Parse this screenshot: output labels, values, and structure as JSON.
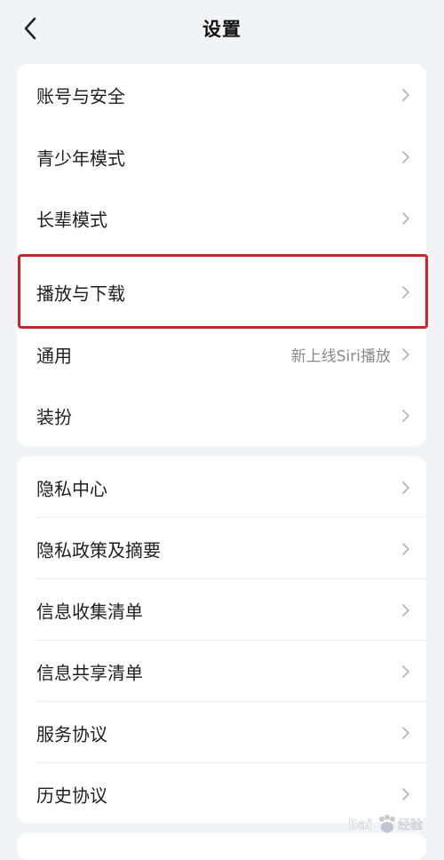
{
  "header": {
    "title": "设置",
    "back_icon": "chevron-left-icon"
  },
  "groups": [
    {
      "items": [
        {
          "label": "账号与安全",
          "hint": ""
        },
        {
          "label": "青少年模式",
          "hint": ""
        },
        {
          "label": "长辈模式",
          "hint": ""
        },
        {
          "label": "播放与下载",
          "hint": "",
          "highlighted": true
        },
        {
          "label": "通用",
          "hint": "新上线Siri播放"
        },
        {
          "label": "装扮",
          "hint": ""
        }
      ]
    },
    {
      "items": [
        {
          "label": "隐私中心",
          "hint": ""
        },
        {
          "label": "隐私政策及摘要",
          "hint": ""
        },
        {
          "label": "信息收集清单",
          "hint": ""
        },
        {
          "label": "信息共享清单",
          "hint": ""
        },
        {
          "label": "服务协议",
          "hint": ""
        },
        {
          "label": "历史协议",
          "hint": ""
        }
      ]
    }
  ],
  "highlight_color": "#d0202a",
  "row_icon": "chevron-right-icon",
  "watermark": {
    "text": "Bai百度 经验"
  }
}
